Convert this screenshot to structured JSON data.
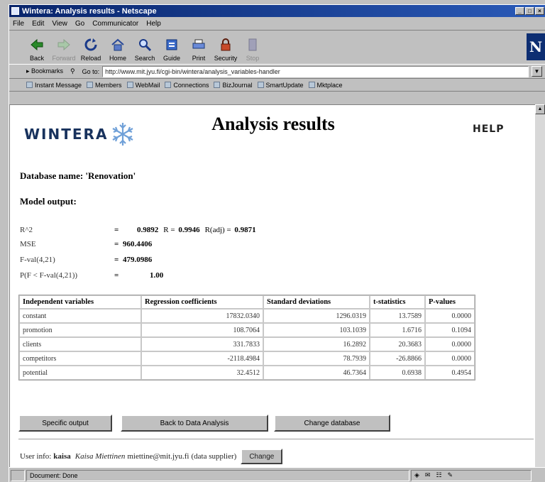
{
  "window": {
    "title": "Wintera: Analysis results - Netscape"
  },
  "menu": [
    "File",
    "Edit",
    "View",
    "Go",
    "Communicator",
    "Help"
  ],
  "toolbar": [
    {
      "label": "Back",
      "icon": "back-arrow-icon",
      "enabled": true
    },
    {
      "label": "Forward",
      "icon": "forward-arrow-icon",
      "enabled": false
    },
    {
      "label": "Reload",
      "icon": "reload-icon",
      "enabled": true
    },
    {
      "label": "Home",
      "icon": "home-icon",
      "enabled": true
    },
    {
      "label": "Search",
      "icon": "search-icon",
      "enabled": true
    },
    {
      "label": "Guide",
      "icon": "guide-icon",
      "enabled": true
    },
    {
      "label": "Print",
      "icon": "print-icon",
      "enabled": true
    },
    {
      "label": "Security",
      "icon": "lock-icon",
      "enabled": true
    },
    {
      "label": "Stop",
      "icon": "stop-icon",
      "enabled": false
    }
  ],
  "location": {
    "bookmarks_label": "Bookmarks",
    "goto_label": "Go to:",
    "url": "http://www.mit.jyu.fi/cgi-bin/wintera/analysis_variables-handler"
  },
  "personal_toolbar": [
    "Instant Message",
    "Members",
    "WebMail",
    "Connections",
    "BizJournal",
    "SmartUpdate",
    "Mktplace"
  ],
  "page": {
    "logo_text": "WINTERA",
    "title": "Analysis results",
    "help": "HELP",
    "database_label": "Database name: 'Renovation'",
    "model_output_label": "Model output:",
    "stats": [
      {
        "name": "R^2",
        "value": "0.9892",
        "extra": [
          {
            "label": "R",
            "value": "0.9946"
          },
          {
            "label": "R(adj)",
            "value": "0.9871"
          }
        ]
      },
      {
        "name": "MSE",
        "value": "960.4406"
      },
      {
        "name": "F-val(4,21)",
        "value": "479.0986"
      },
      {
        "name": "P(F < F-val(4,21))",
        "value": "1.00"
      }
    ],
    "table": {
      "headers": [
        "Independent variables",
        "Regression coefficients",
        "Standard deviations",
        "t-statistics",
        "P-values"
      ],
      "rows": [
        [
          "constant",
          "17832.0340",
          "1296.0319",
          "13.7589",
          "0.0000"
        ],
        [
          "promotion",
          "108.7064",
          "103.1039",
          "1.6716",
          "0.1094"
        ],
        [
          "clients",
          "331.7833",
          "16.2892",
          "20.3683",
          "0.0000"
        ],
        [
          "competitors",
          "-2118.4984",
          "78.7939",
          "-26.8866",
          "0.0000"
        ],
        [
          "potential",
          "32.4512",
          "46.7364",
          "0.6938",
          "0.4954"
        ]
      ]
    },
    "buttons": [
      "Specific output",
      "Back to Data Analysis",
      "Change database"
    ],
    "user_info": {
      "prefix": "User info:",
      "user": "kaisa",
      "name": "Kaisa Miettinen",
      "email": "miettine@mit.jyu.fi",
      "role": "(data supplier)",
      "change": "Change"
    }
  },
  "status": {
    "text": "Document: Done"
  },
  "colors": {
    "titlebar": "#08246b",
    "logo": "#18325d",
    "chrome": "#c0c0c0"
  }
}
